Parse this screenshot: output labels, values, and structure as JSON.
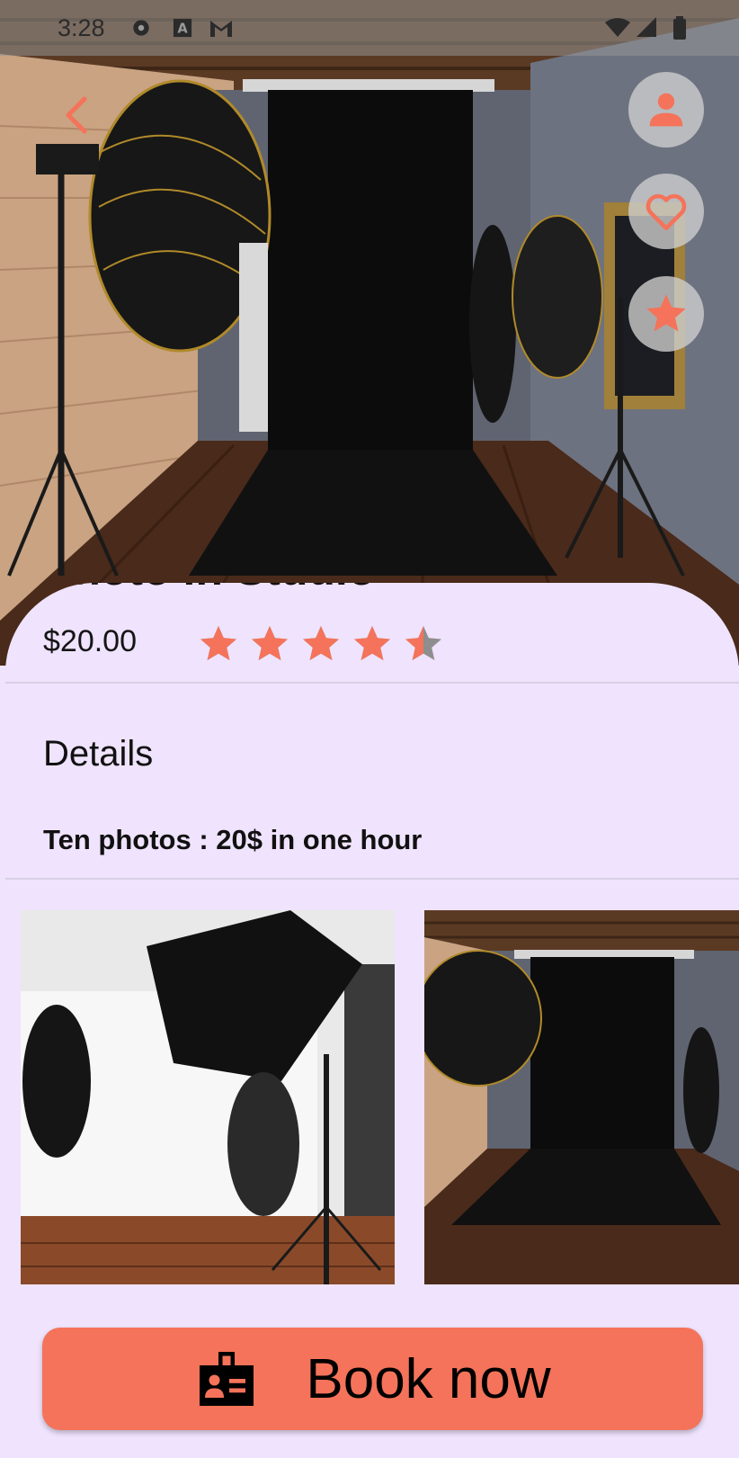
{
  "status_bar": {
    "time": "3:28",
    "icons": [
      "settings-icon",
      "font-icon",
      "gmail-icon",
      "wifi-icon",
      "signal-icon",
      "battery-icon"
    ]
  },
  "colors": {
    "accent": "#f4735a",
    "sheet_bg": "#efe3fd"
  },
  "header": {
    "back_icon": "chevron-left-icon",
    "actions": [
      {
        "name": "profile",
        "icon": "person-icon"
      },
      {
        "name": "favorite",
        "icon": "heart-icon"
      },
      {
        "name": "rate",
        "icon": "star-icon"
      }
    ]
  },
  "product": {
    "title": "Photo in Studio",
    "price": "$20.00",
    "rating": 4.5,
    "rating_max": 5
  },
  "details": {
    "heading": "Details",
    "text": "Ten photos : 20$ in one hour"
  },
  "gallery": [
    {
      "name": "white-studio-photo"
    },
    {
      "name": "black-backdrop-studio-photo"
    }
  ],
  "book_button": {
    "label": "Book now",
    "icon": "badge-icon"
  }
}
